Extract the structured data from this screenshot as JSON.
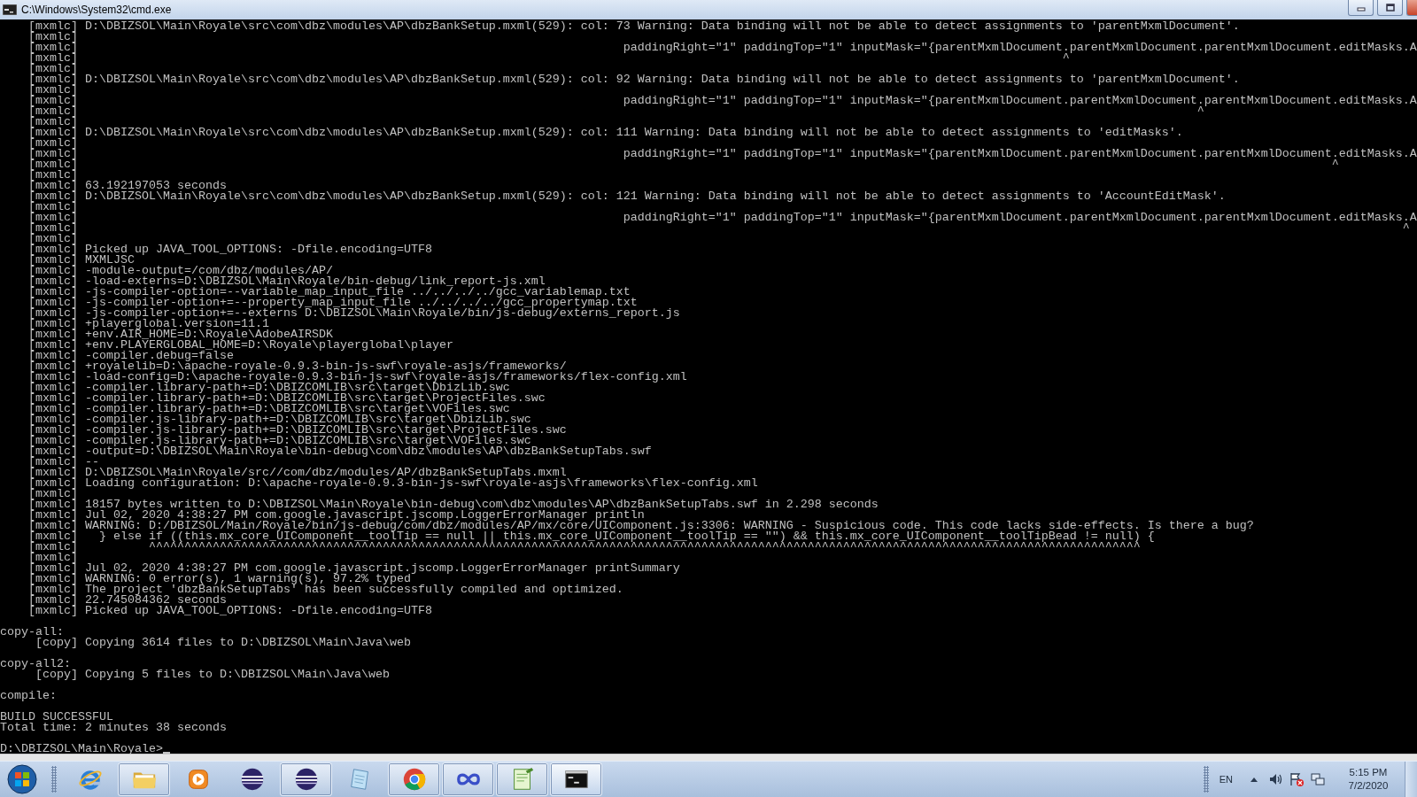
{
  "window": {
    "title": "C:\\Windows\\System32\\cmd.exe"
  },
  "console": {
    "blocks": [
      [
        "    [mxmlc] D:\\DBIZSOL\\Main\\Royale\\src\\com\\dbz\\modules\\AP\\dbzBankSetup.mxml(529): col: 73 Warning: Data binding will not be able to detect assignments to 'parentMxmlDocument'.",
        "    [mxmlc]",
        "    [mxmlc]                                                                             paddingRight=\"1\" paddingTop=\"1\" inputMask=\"{parentMxmlDocument.parentMxmlDocument.parentMxmlDocument.editMasks.A",
        "    [mxmlc]                                                                                                                                           ^",
        "    [mxmlc]",
        "    [mxmlc] D:\\DBIZSOL\\Main\\Royale\\src\\com\\dbz\\modules\\AP\\dbzBankSetup.mxml(529): col: 92 Warning: Data binding will not be able to detect assignments to 'parentMxmlDocument'.",
        "    [mxmlc]",
        "    [mxmlc]                                                                             paddingRight=\"1\" paddingTop=\"1\" inputMask=\"{parentMxmlDocument.parentMxmlDocument.parentMxmlDocument.editMasks.A",
        "    [mxmlc]                                                                                                                                                              ^",
        "    [mxmlc]",
        "    [mxmlc] D:\\DBIZSOL\\Main\\Royale\\src\\com\\dbz\\modules\\AP\\dbzBankSetup.mxml(529): col: 111 Warning: Data binding will not be able to detect assignments to 'editMasks'.",
        "    [mxmlc]",
        "    [mxmlc]                                                                             paddingRight=\"1\" paddingTop=\"1\" inputMask=\"{parentMxmlDocument.parentMxmlDocument.parentMxmlDocument.editMasks.A",
        "    [mxmlc]                                                                                                                                                                                 ^",
        "    [mxmlc]",
        "    [mxmlc] 63.192197053 seconds",
        "    [mxmlc] D:\\DBIZSOL\\Main\\Royale\\src\\com\\dbz\\modules\\AP\\dbzBankSetup.mxml(529): col: 121 Warning: Data binding will not be able to detect assignments to 'AccountEditMask'.",
        "    [mxmlc]",
        "    [mxmlc]                                                                             paddingRight=\"1\" paddingTop=\"1\" inputMask=\"{parentMxmlDocument.parentMxmlDocument.parentMxmlDocument.editMasks.A",
        "    [mxmlc]                                                                                                                                                                                           ^",
        "    [mxmlc]",
        "    [mxmlc] Picked up JAVA_TOOL_OPTIONS: -Dfile.encoding=UTF8",
        "    [mxmlc] MXMLJSC",
        "    [mxmlc] -module-output=/com/dbz/modules/AP/",
        "    [mxmlc] -load-externs=D:\\DBIZSOL\\Main\\Royale/bin-debug/link_report-js.xml",
        "    [mxmlc] -js-compiler-option=--variable_map_input_file ../../../../gcc_variablemap.txt",
        "    [mxmlc] -js-compiler-option+=--property_map_input_file ../../../../gcc_propertymap.txt",
        "    [mxmlc] -js-compiler-option+=--externs D:\\DBIZSOL\\Main\\Royale/bin/js-debug/externs_report.js",
        "    [mxmlc] +playerglobal.version=11.1",
        "    [mxmlc] +env.AIR_HOME=D:\\Royale\\AdobeAIRSDK",
        "    [mxmlc] +env.PLAYERGLOBAL_HOME=D:\\Royale\\playerglobal\\player",
        "    [mxmlc] -compiler.debug=false",
        "    [mxmlc] +royalelib=D:\\apache-royale-0.9.3-bin-js-swf\\royale-asjs/frameworks/",
        "    [mxmlc] -load-config=D:\\apache-royale-0.9.3-bin-js-swf\\royale-asjs/frameworks/flex-config.xml",
        "    [mxmlc] -compiler.library-path+=D:\\DBIZCOMLIB\\src\\target\\DbizLib.swc",
        "    [mxmlc] -compiler.library-path+=D:\\DBIZCOMLIB\\src\\target\\ProjectFiles.swc",
        "    [mxmlc] -compiler.library-path+=D:\\DBIZCOMLIB\\src\\target\\VOFiles.swc",
        "    [mxmlc] -compiler.js-library-path+=D:\\DBIZCOMLIB\\src\\target\\DbizLib.swc",
        "    [mxmlc] -compiler.js-library-path+=D:\\DBIZCOMLIB\\src\\target\\ProjectFiles.swc",
        "    [mxmlc] -compiler.js-library-path+=D:\\DBIZCOMLIB\\src\\target\\VOFiles.swc",
        "    [mxmlc] -output=D:\\DBIZSOL\\Main\\Royale\\bin-debug\\com\\dbz\\modules\\AP\\dbzBankSetupTabs.swf",
        "    [mxmlc] --",
        "    [mxmlc] D:\\DBIZSOL\\Main\\Royale/src//com/dbz/modules/AP/dbzBankSetupTabs.mxml",
        "    [mxmlc] Loading configuration: D:\\apache-royale-0.9.3-bin-js-swf\\royale-asjs\\frameworks\\flex-config.xml",
        "    [mxmlc]",
        "    [mxmlc] 18157 bytes written to D:\\DBIZSOL\\Main\\Royale\\bin-debug\\com\\dbz\\modules\\AP\\dbzBankSetupTabs.swf in 2.298 seconds",
        "    [mxmlc] Jul 02, 2020 4:38:27 PM com.google.javascript.jscomp.LoggerErrorManager println",
        "    [mxmlc] WARNING: D:/DBIZSOL/Main/Royale/bin/js-debug/com/dbz/modules/AP/mx/core/UIComponent.js:3306: WARNING - Suspicious code. This code lacks side-effects. Is there a bug?",
        "    [mxmlc]   } else if ((this.mx_core_UIComponent__toolTip == null || this.mx_core_UIComponent__toolTip == \"\") && this.mx_core_UIComponent__toolTipBead != null) {",
        "    [mxmlc]          ^^^^^^^^^^^^^^^^^^^^^^^^^^^^^^^^^^^^^^^^^^^^^^^^^^^^^^^^^^^^^^^^^^^^^^^^^^^^^^^^^^^^^^^^^^^^^^^^^^^^^^^^^^^^^^^^^^^^^^^^^^^^^^^^^^^^^^^^^^^^",
        "    [mxmlc]",
        "    [mxmlc] Jul 02, 2020 4:38:27 PM com.google.javascript.jscomp.LoggerErrorManager printSummary",
        "    [mxmlc] WARNING: 0 error(s), 1 warning(s), 97.2% typed",
        "    [mxmlc] The project 'dbzBankSetupTabs' has been successfully compiled and optimized.",
        "    [mxmlc] 22.745084362 seconds",
        "    [mxmlc] Picked up JAVA_TOOL_OPTIONS: -Dfile.encoding=UTF8"
      ],
      [
        "copy-all:",
        "     [copy] Copying 3614 files to D:\\DBIZSOL\\Main\\Java\\web"
      ],
      [
        "copy-all2:",
        "     [copy] Copying 5 files to D:\\DBIZSOL\\Main\\Java\\web"
      ],
      [
        "compile:"
      ],
      [
        "BUILD SUCCESSFUL",
        "Total time: 2 minutes 38 seconds"
      ]
    ],
    "prompt": "D:\\DBIZSOL\\Main\\Royale>"
  },
  "taskbar": {
    "items": [
      {
        "kind": "ie",
        "running": false,
        "selected": false
      },
      {
        "kind": "folder",
        "running": true,
        "selected": false
      },
      {
        "kind": "media",
        "running": false,
        "selected": false
      },
      {
        "kind": "sphere",
        "running": false,
        "selected": false
      },
      {
        "kind": "sphere",
        "running": true,
        "selected": false
      },
      {
        "kind": "notepad",
        "running": false,
        "selected": false
      },
      {
        "kind": "chrome",
        "running": true,
        "selected": false
      },
      {
        "kind": "infinity",
        "running": true,
        "selected": false
      },
      {
        "kind": "npp",
        "running": true,
        "selected": false
      },
      {
        "kind": "cmd",
        "running": true,
        "selected": true
      }
    ]
  },
  "tray": {
    "language": "EN",
    "time": "5:15 PM",
    "date": "7/2/2020"
  }
}
